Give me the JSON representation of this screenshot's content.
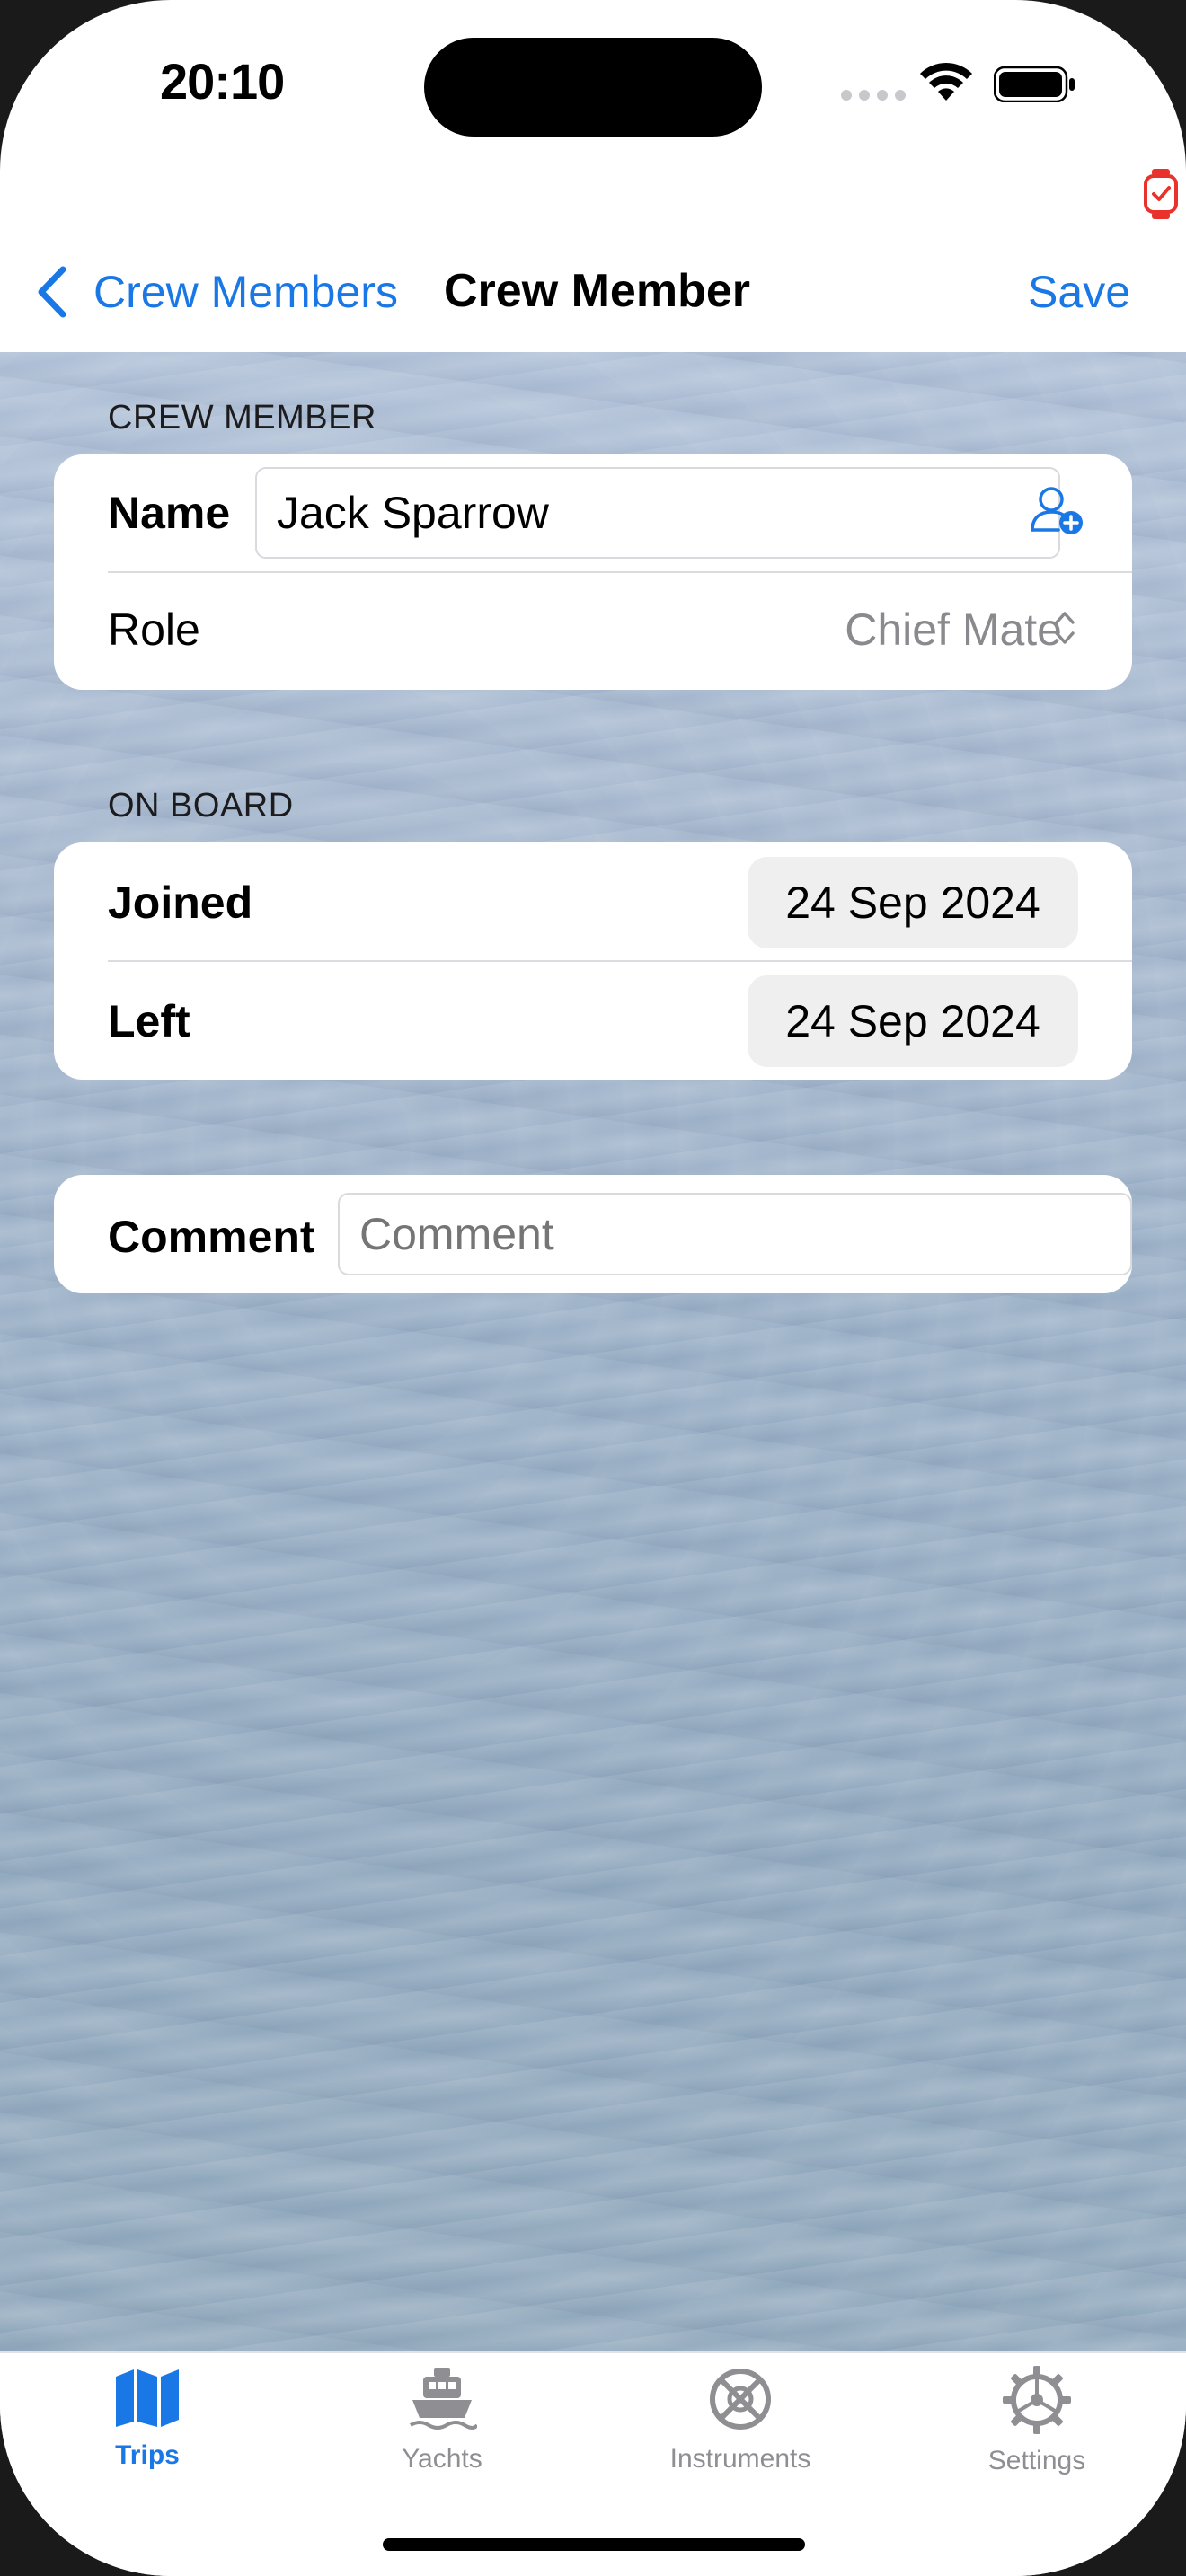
{
  "status_bar": {
    "time": "20:10"
  },
  "nav": {
    "back_label": "Crew Members",
    "title": "Crew Member",
    "save_label": "Save"
  },
  "crew_member_section": {
    "header": "CREW MEMBER",
    "name_label": "Name",
    "name_value": "Jack Sparrow",
    "role_label": "Role",
    "role_value": "Chief Mate"
  },
  "on_board_section": {
    "header": "ON BOARD",
    "joined_label": "Joined",
    "joined_value": "24 Sep 2024",
    "left_label": "Left",
    "left_value": "24 Sep 2024"
  },
  "comment_section": {
    "label": "Comment",
    "value": "",
    "placeholder": "Comment"
  },
  "tabs": [
    {
      "label": "Trips",
      "icon": "map-icon",
      "active": true
    },
    {
      "label": "Yachts",
      "icon": "ferry-icon",
      "active": false
    },
    {
      "label": "Instruments",
      "icon": "instruments-icon",
      "active": false
    },
    {
      "label": "Settings",
      "icon": "gear-icon",
      "active": false
    }
  ],
  "colors": {
    "accent": "#1a78e6",
    "inactive": "#8e8e93",
    "watch_badge": "#e8322b"
  }
}
